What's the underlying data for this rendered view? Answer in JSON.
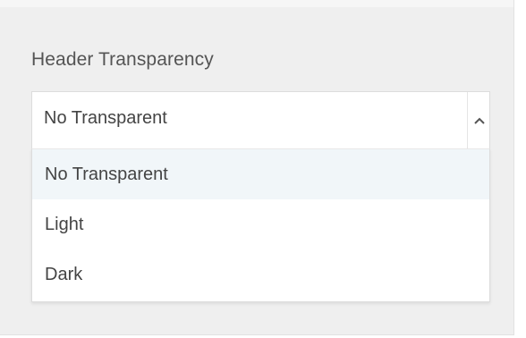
{
  "section": {
    "title": "Header Transparency"
  },
  "select": {
    "value": "No Transparent",
    "icon": "chevron-up-icon",
    "options": [
      {
        "label": "No Transparent",
        "highlighted": true
      },
      {
        "label": "Light",
        "highlighted": false
      },
      {
        "label": "Dark",
        "highlighted": false
      }
    ]
  },
  "colors": {
    "panel_bg": "#efefef",
    "text": "#444444",
    "title_text": "#545454",
    "highlight_bg": "#f1f6f9",
    "border": "#dcdcdc"
  }
}
